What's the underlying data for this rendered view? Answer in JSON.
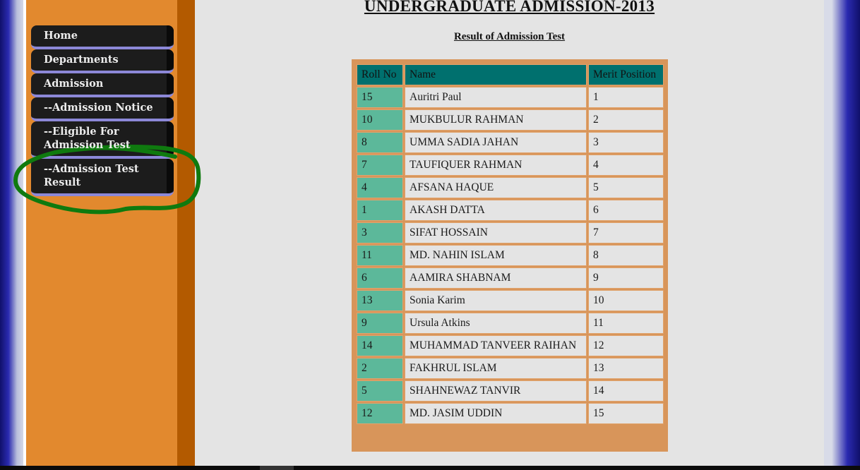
{
  "nav": {
    "items": [
      {
        "label": "Home"
      },
      {
        "label": "Departments"
      },
      {
        "label": "Admission"
      },
      {
        "label": "--Admission Notice"
      },
      {
        "label": "--Eligible For Admission Test"
      },
      {
        "label": "--Admission Test Result"
      }
    ]
  },
  "page": {
    "title": "UNDERGRADUATE ADMISSION-2013",
    "subtitle": "Result of Admission Test"
  },
  "table": {
    "headers": [
      "Roll No",
      "Name",
      "Merit Position"
    ],
    "rows": [
      [
        "15",
        "Auritri Paul",
        "1"
      ],
      [
        "10",
        "MUKBULUR RAHMAN",
        "2"
      ],
      [
        "8",
        "UMMA SADIA JAHAN",
        "3"
      ],
      [
        "7",
        "TAUFIQUER RAHMAN",
        "4"
      ],
      [
        "4",
        "AFSANA HAQUE",
        "5"
      ],
      [
        "1",
        "AKASH DATTA",
        "6"
      ],
      [
        "3",
        "SIFAT HOSSAIN",
        "7"
      ],
      [
        "11",
        "MD. NAHIN ISLAM",
        "8"
      ],
      [
        "6",
        "AAMIRA SHABNAM",
        "9"
      ],
      [
        "13",
        "Sonia Karim",
        "10"
      ],
      [
        "9",
        "Ursula Atkins",
        "11"
      ],
      [
        "14",
        "MUHAMMAD TANVEER RAIHAN",
        "12"
      ],
      [
        "2",
        "FAKHRUL ISLAM",
        "13"
      ],
      [
        "5",
        "SHAHNEWAZ TANVIR",
        "14"
      ],
      [
        "12",
        "MD. JASIM UDDIN",
        "15"
      ]
    ]
  },
  "colors": {
    "sidebar": "#e2892e",
    "sidebar_strip": "#b35a00",
    "header_cell": "#00706e",
    "roll_cell": "#5cb89a",
    "annotation": "#0f7a0f"
  }
}
